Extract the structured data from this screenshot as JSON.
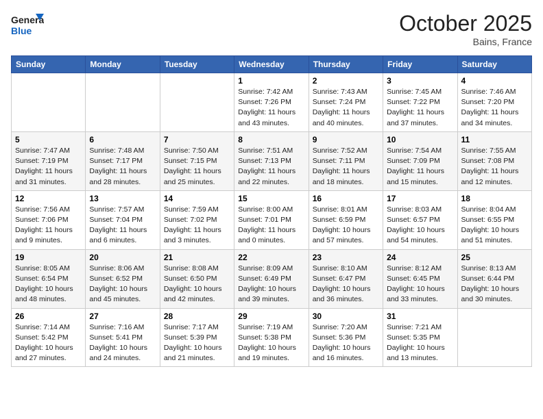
{
  "header": {
    "logo_general": "General",
    "logo_blue": "Blue",
    "month": "October 2025",
    "location": "Bains, France"
  },
  "days_of_week": [
    "Sunday",
    "Monday",
    "Tuesday",
    "Wednesday",
    "Thursday",
    "Friday",
    "Saturday"
  ],
  "weeks": [
    [
      {
        "day": "",
        "info": ""
      },
      {
        "day": "",
        "info": ""
      },
      {
        "day": "",
        "info": ""
      },
      {
        "day": "1",
        "info": "Sunrise: 7:42 AM\nSunset: 7:26 PM\nDaylight: 11 hours\nand 43 minutes."
      },
      {
        "day": "2",
        "info": "Sunrise: 7:43 AM\nSunset: 7:24 PM\nDaylight: 11 hours\nand 40 minutes."
      },
      {
        "day": "3",
        "info": "Sunrise: 7:45 AM\nSunset: 7:22 PM\nDaylight: 11 hours\nand 37 minutes."
      },
      {
        "day": "4",
        "info": "Sunrise: 7:46 AM\nSunset: 7:20 PM\nDaylight: 11 hours\nand 34 minutes."
      }
    ],
    [
      {
        "day": "5",
        "info": "Sunrise: 7:47 AM\nSunset: 7:19 PM\nDaylight: 11 hours\nand 31 minutes."
      },
      {
        "day": "6",
        "info": "Sunrise: 7:48 AM\nSunset: 7:17 PM\nDaylight: 11 hours\nand 28 minutes."
      },
      {
        "day": "7",
        "info": "Sunrise: 7:50 AM\nSunset: 7:15 PM\nDaylight: 11 hours\nand 25 minutes."
      },
      {
        "day": "8",
        "info": "Sunrise: 7:51 AM\nSunset: 7:13 PM\nDaylight: 11 hours\nand 22 minutes."
      },
      {
        "day": "9",
        "info": "Sunrise: 7:52 AM\nSunset: 7:11 PM\nDaylight: 11 hours\nand 18 minutes."
      },
      {
        "day": "10",
        "info": "Sunrise: 7:54 AM\nSunset: 7:09 PM\nDaylight: 11 hours\nand 15 minutes."
      },
      {
        "day": "11",
        "info": "Sunrise: 7:55 AM\nSunset: 7:08 PM\nDaylight: 11 hours\nand 12 minutes."
      }
    ],
    [
      {
        "day": "12",
        "info": "Sunrise: 7:56 AM\nSunset: 7:06 PM\nDaylight: 11 hours\nand 9 minutes."
      },
      {
        "day": "13",
        "info": "Sunrise: 7:57 AM\nSunset: 7:04 PM\nDaylight: 11 hours\nand 6 minutes."
      },
      {
        "day": "14",
        "info": "Sunrise: 7:59 AM\nSunset: 7:02 PM\nDaylight: 11 hours\nand 3 minutes."
      },
      {
        "day": "15",
        "info": "Sunrise: 8:00 AM\nSunset: 7:01 PM\nDaylight: 11 hours\nand 0 minutes."
      },
      {
        "day": "16",
        "info": "Sunrise: 8:01 AM\nSunset: 6:59 PM\nDaylight: 10 hours\nand 57 minutes."
      },
      {
        "day": "17",
        "info": "Sunrise: 8:03 AM\nSunset: 6:57 PM\nDaylight: 10 hours\nand 54 minutes."
      },
      {
        "day": "18",
        "info": "Sunrise: 8:04 AM\nSunset: 6:55 PM\nDaylight: 10 hours\nand 51 minutes."
      }
    ],
    [
      {
        "day": "19",
        "info": "Sunrise: 8:05 AM\nSunset: 6:54 PM\nDaylight: 10 hours\nand 48 minutes."
      },
      {
        "day": "20",
        "info": "Sunrise: 8:06 AM\nSunset: 6:52 PM\nDaylight: 10 hours\nand 45 minutes."
      },
      {
        "day": "21",
        "info": "Sunrise: 8:08 AM\nSunset: 6:50 PM\nDaylight: 10 hours\nand 42 minutes."
      },
      {
        "day": "22",
        "info": "Sunrise: 8:09 AM\nSunset: 6:49 PM\nDaylight: 10 hours\nand 39 minutes."
      },
      {
        "day": "23",
        "info": "Sunrise: 8:10 AM\nSunset: 6:47 PM\nDaylight: 10 hours\nand 36 minutes."
      },
      {
        "day": "24",
        "info": "Sunrise: 8:12 AM\nSunset: 6:45 PM\nDaylight: 10 hours\nand 33 minutes."
      },
      {
        "day": "25",
        "info": "Sunrise: 8:13 AM\nSunset: 6:44 PM\nDaylight: 10 hours\nand 30 minutes."
      }
    ],
    [
      {
        "day": "26",
        "info": "Sunrise: 7:14 AM\nSunset: 5:42 PM\nDaylight: 10 hours\nand 27 minutes."
      },
      {
        "day": "27",
        "info": "Sunrise: 7:16 AM\nSunset: 5:41 PM\nDaylight: 10 hours\nand 24 minutes."
      },
      {
        "day": "28",
        "info": "Sunrise: 7:17 AM\nSunset: 5:39 PM\nDaylight: 10 hours\nand 21 minutes."
      },
      {
        "day": "29",
        "info": "Sunrise: 7:19 AM\nSunset: 5:38 PM\nDaylight: 10 hours\nand 19 minutes."
      },
      {
        "day": "30",
        "info": "Sunrise: 7:20 AM\nSunset: 5:36 PM\nDaylight: 10 hours\nand 16 minutes."
      },
      {
        "day": "31",
        "info": "Sunrise: 7:21 AM\nSunset: 5:35 PM\nDaylight: 10 hours\nand 13 minutes."
      },
      {
        "day": "",
        "info": ""
      }
    ]
  ]
}
